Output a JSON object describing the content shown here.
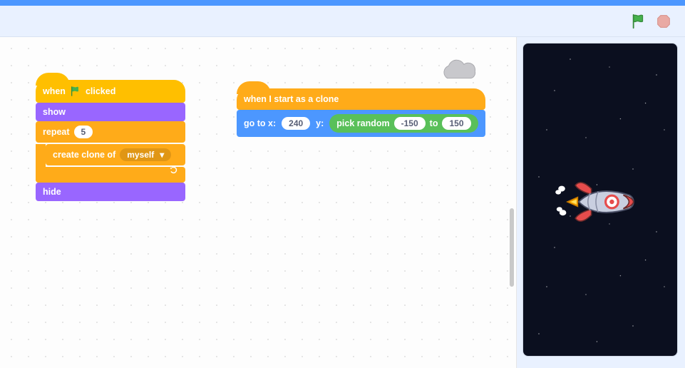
{
  "header": {
    "flag_name": "green-flag",
    "stop_name": "stop-sign"
  },
  "stack1": {
    "hat": {
      "pre": "when",
      "post": "clicked"
    },
    "show": "show",
    "repeat": {
      "label": "repeat",
      "count": "5"
    },
    "clone": {
      "label": "create clone of",
      "option": "myself"
    },
    "hide": "hide"
  },
  "stack2": {
    "hat": "when I start as a clone",
    "go": {
      "pre": "go to x:",
      "x": "240",
      "mid": "y:",
      "rand_label": "pick random",
      "rand_from": "-150",
      "rand_to_word": "to",
      "rand_to": "150"
    }
  },
  "stage": {
    "sprite": "rocket"
  }
}
